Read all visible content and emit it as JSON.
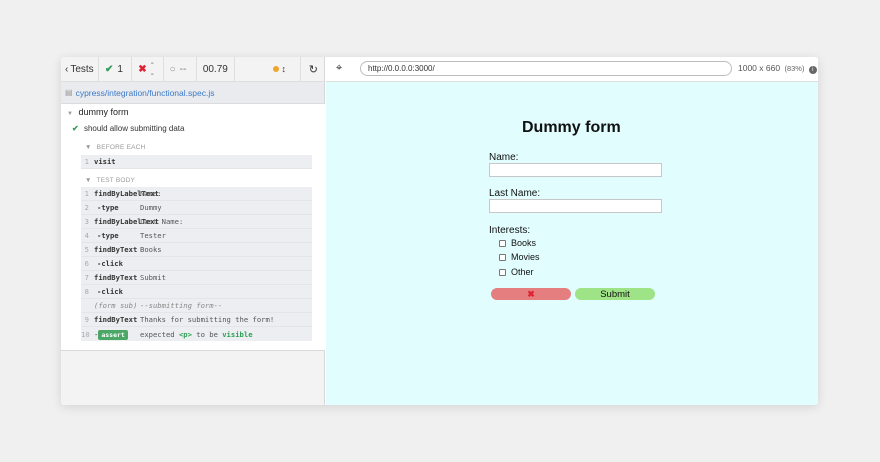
{
  "reporter": {
    "back_label": "Tests",
    "passed": "1",
    "failed": "--",
    "pending": "--",
    "duration": "00.79",
    "spec_path": "cypress/integration/functional.spec.js",
    "suite": "dummy form",
    "test": "should allow submitting data",
    "before_each_label": "BEFORE EACH",
    "test_body_label": "TEST BODY",
    "before_each": [
      {
        "num": "1",
        "name": "visit",
        "msg": ""
      }
    ],
    "body": [
      {
        "num": "1",
        "name": "findByLabelText",
        "msg": "Name:"
      },
      {
        "num": "2",
        "name": "-type",
        "msg": "Dummy"
      },
      {
        "num": "3",
        "name": "findByLabelText",
        "msg": "Last Name:"
      },
      {
        "num": "4",
        "name": "-type",
        "msg": "Tester"
      },
      {
        "num": "5",
        "name": "findByText",
        "msg": "Books"
      },
      {
        "num": "6",
        "name": "-click",
        "msg": ""
      },
      {
        "num": "7",
        "name": "findByText",
        "msg": "Submit"
      },
      {
        "num": "8",
        "name": "-click",
        "msg": ""
      },
      {
        "num": "",
        "name": "(form sub)",
        "msg": "--submitting form--"
      },
      {
        "num": "9",
        "name": "findByText",
        "msg": "Thanks for submitting the form!"
      }
    ],
    "assert": {
      "num": "10",
      "badge": "assert",
      "expected": "expected",
      "subject": "<p>",
      "to_be": "to be",
      "state": "visible"
    }
  },
  "browser": {
    "url": "http://0.0.0.0:3000/",
    "viewport": "1000 x 660",
    "zoom": "(83%)"
  },
  "form": {
    "title": "Dummy form",
    "name_label": "Name:",
    "last_name_label": "Last Name:",
    "interests_label": "Interests:",
    "options": [
      "Books",
      "Movies",
      "Other"
    ],
    "cancel_label": "✖",
    "submit_label": "Submit"
  },
  "colors": {
    "aut_background": "#e1fdfe",
    "pass_green": "#2f9e56",
    "fail_red": "#d23",
    "submit_green": "#9ee386",
    "cancel_red": "#e57f7f"
  }
}
